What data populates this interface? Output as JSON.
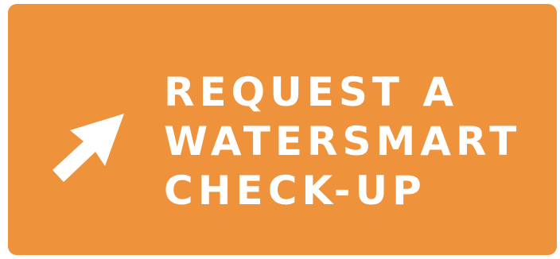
{
  "cta": {
    "lines": [
      "REQUEST A",
      "WATERSMART",
      "CHECK-UP"
    ],
    "icon": "pointer-arrow-icon",
    "colors": {
      "background": "#ee923b",
      "text": "#ffffff",
      "icon": "#ffffff"
    }
  }
}
